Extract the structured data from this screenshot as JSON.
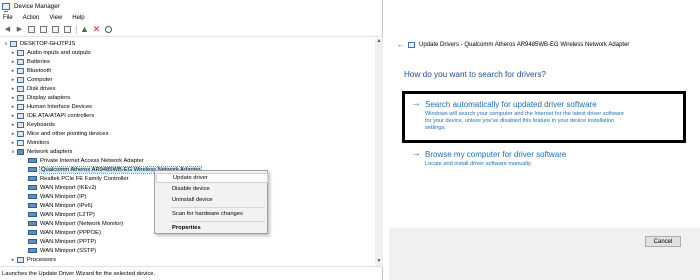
{
  "device_manager": {
    "title": "Device Manager",
    "menu": [
      "File",
      "Action",
      "View",
      "Help"
    ],
    "tree": {
      "root": "DESKTOP-GHJTPJS",
      "categories": [
        "Audio inputs and outputs",
        "Batteries",
        "Bluetooth",
        "Computer",
        "Disk drives",
        "Display adapters",
        "Human Interface Devices",
        "IDE ATA/ATAPI controllers",
        "Keyboards",
        "Mice and other pointing devices",
        "Monitors",
        "Network adapters"
      ],
      "network_adapters": [
        "Private Internet Access Network Adapter",
        "Qualcomm Atheros AR9485WB-EG Wireless Network Adapter",
        "Realtek PCIe FE Family Controller",
        "WAN Miniport (IKEv2)",
        "WAN Miniport (IP)",
        "WAN Miniport (IPv6)",
        "WAN Miniport (L2TP)",
        "WAN Miniport (Network Monitor)",
        "WAN Miniport (PPPOE)",
        "WAN Miniport (PPTP)",
        "WAN Miniport (SSTP)"
      ],
      "after": "Processors"
    },
    "context_menu": {
      "update_driver": "Update driver",
      "disable_device": "Disable device",
      "uninstall_device": "Uninstall device",
      "scan": "Scan for hardware changes",
      "properties": "Properties"
    },
    "status": "Launches the Update Driver Wizard for the selected device."
  },
  "update_drivers": {
    "title": "Update Drivers - Qualcomm Atheros AR9485WB-EG Wireless Network Adapter",
    "question": "How do you want to search for drivers?",
    "option_auto": {
      "title": "Search automatically for updated driver software",
      "desc": "Windows will search your computer and the Internet for the latest driver software for your device, unless you've disabled this feature in your device installation settings."
    },
    "option_browse": {
      "title": "Browse my computer for driver software",
      "desc": "Locate and install driver software manually."
    },
    "cancel": "Cancel"
  },
  "colors": {
    "link_blue": "#1e6fb5",
    "heading_blue": "#1e4e86",
    "selection": "#cce8ff"
  }
}
